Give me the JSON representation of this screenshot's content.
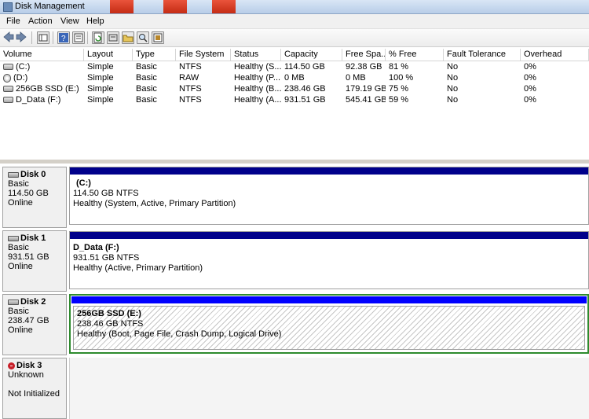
{
  "window": {
    "title": "Disk Management"
  },
  "menu": [
    "File",
    "Action",
    "View",
    "Help"
  ],
  "toolbar": {
    "buttons": [
      "back-arrow-icon",
      "forward-arrow-icon",
      "console-tree-icon",
      "properties-icon",
      "help-icon",
      "list-view-icon",
      "refresh-icon",
      "export-list-icon",
      "open-icon",
      "search-icon",
      "settings-icon"
    ]
  },
  "volumes": {
    "columns": [
      "Volume",
      "Layout",
      "Type",
      "File System",
      "Status",
      "Capacity",
      "Free Spa...",
      "% Free",
      "Fault Tolerance",
      "Overhead"
    ],
    "rows": [
      {
        "icon": "drive",
        "volume": "(C:)",
        "layout": "Simple",
        "type": "Basic",
        "fs": "NTFS",
        "status": "Healthy (S...",
        "capacity": "114.50 GB",
        "free": "92.38 GB",
        "pct": "81 %",
        "fault": "No",
        "overhead": "0%"
      },
      {
        "icon": "cd",
        "volume": "(D:)",
        "layout": "Simple",
        "type": "Basic",
        "fs": "RAW",
        "status": "Healthy (P...",
        "capacity": "0 MB",
        "free": "0 MB",
        "pct": "100 %",
        "fault": "No",
        "overhead": "0%"
      },
      {
        "icon": "drive",
        "volume": "256GB SSD (E:)",
        "layout": "Simple",
        "type": "Basic",
        "fs": "NTFS",
        "status": "Healthy (B...",
        "capacity": "238.46 GB",
        "free": "179.19 GB",
        "pct": "75 %",
        "fault": "No",
        "overhead": "0%"
      },
      {
        "icon": "drive",
        "volume": "D_Data (F:)",
        "layout": "Simple",
        "type": "Basic",
        "fs": "NTFS",
        "status": "Healthy (A...",
        "capacity": "931.51 GB",
        "free": "545.41 GB",
        "pct": "59 %",
        "fault": "No",
        "overhead": "0%"
      }
    ]
  },
  "disks": [
    {
      "name": "Disk 0",
      "type": "Basic",
      "size": "114.50 GB",
      "state": "Online",
      "partition": {
        "name": "(C:)",
        "size_fs": "114.50 GB NTFS",
        "status": "Healthy (System, Active, Primary Partition)"
      }
    },
    {
      "name": "Disk 1",
      "type": "Basic",
      "size": "931.51 GB",
      "state": "Online",
      "partition": {
        "name": "D_Data  (F:)",
        "size_fs": "931.51 GB NTFS",
        "status": "Healthy (Active, Primary Partition)"
      }
    },
    {
      "name": "Disk 2",
      "type": "Basic",
      "size": "238.47 GB",
      "state": "Online",
      "partition": {
        "name": "256GB SSD  (E:)",
        "size_fs": "238.46 GB NTFS",
        "status": "Healthy (Boot, Page File, Crash Dump, Logical Drive)"
      }
    },
    {
      "name": "Disk 3",
      "type": "Unknown",
      "state": "Not Initialized"
    }
  ],
  "colors": {
    "primary_bar": "#00008b",
    "logical_bar": "#0000ff",
    "selected_border": "#2e8b2e"
  }
}
